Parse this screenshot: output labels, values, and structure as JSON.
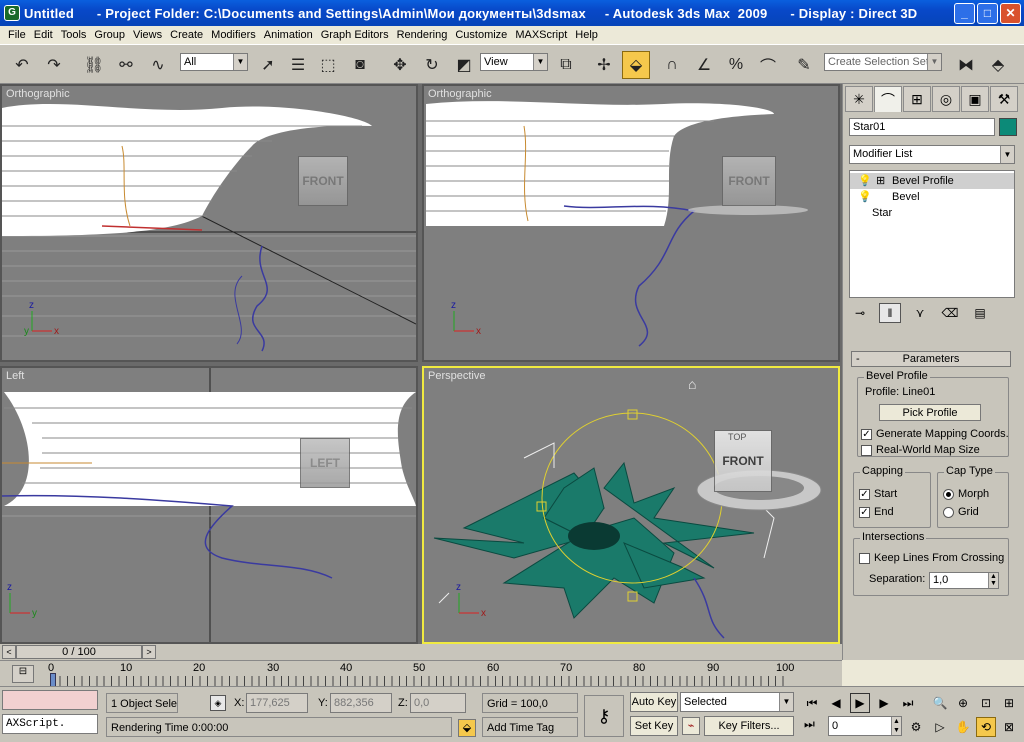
{
  "titlebar": {
    "title": "Untitled      - Project Folder: C:\\Documents and Settings\\Admin\\Мои документы\\3dsmax     - Autodesk 3ds Max  2009      - Display : Direct 3D",
    "minimize": "_",
    "maximize": "□",
    "close": "✕"
  },
  "menu": [
    "File",
    "Edit",
    "Tools",
    "Group",
    "Views",
    "Create",
    "Modifiers",
    "Animation",
    "Graph Editors",
    "Rendering",
    "Customize",
    "MAXScript",
    "Help"
  ],
  "toolbar": {
    "filter": "All",
    "refcoord": "View",
    "selection_set_placeholder": "Create Selection Set"
  },
  "viewports": {
    "top_left": "Orthographic",
    "top_right": "Orthographic",
    "bottom_left": "Left",
    "bottom_right": "Perspective",
    "cube_front": "FRONT",
    "cube_left": "LEFT",
    "cube_top": "TOP",
    "axis_x": "x",
    "axis_y": "y",
    "axis_z": "z"
  },
  "command_panel": {
    "object_name": "Star01",
    "object_color": "#0c8a78",
    "modifier_list": "Modifier List",
    "stack": [
      "Bevel Profile",
      "Bevel",
      "Star"
    ],
    "parameters_title": "Parameters",
    "rollout_minus": "-",
    "bevel_profile_group": "Bevel Profile",
    "profile_label": "Profile: Line01",
    "pick_profile": "Pick Profile",
    "generate_mapping": "Generate Mapping Coords.",
    "real_world": "Real-World Map Size",
    "capping_group": "Capping",
    "cap_start": "Start",
    "cap_end": "End",
    "cap_type_group": "Cap Type",
    "morph": "Morph",
    "grid": "Grid",
    "intersections_group": "Intersections",
    "keep_lines": "Keep Lines From Crossing",
    "separation_label": "Separation:",
    "separation_value": "1,0"
  },
  "timeline": {
    "frame": "0 / 100",
    "ticks": [
      "0",
      "10",
      "20",
      "30",
      "40",
      "50",
      "60",
      "70",
      "80",
      "90",
      "100"
    ]
  },
  "status": {
    "script": "AXScript.",
    "selected": "1 Object Sele",
    "x_label": "X:",
    "x_value": "177,625",
    "y_label": "Y:",
    "y_value": "882,356",
    "z_label": "Z:",
    "z_value": "0,0",
    "grid": "Grid = 100,0",
    "rendering_time": "Rendering Time  0:00:00",
    "add_time_tag": "Add Time Tag",
    "auto_key": "Auto Key",
    "set_key": "Set Key",
    "key_mode": "Selected",
    "key_filters": "Key Filters...",
    "frame_value": "0"
  }
}
